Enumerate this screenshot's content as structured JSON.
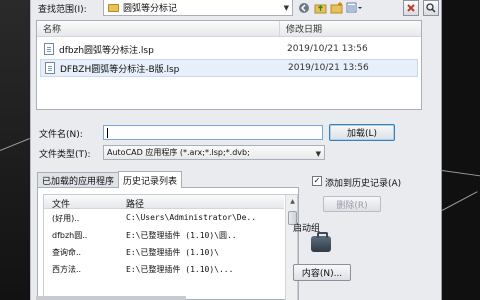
{
  "background": {
    "left_color": "#222222",
    "right_color": "#101010"
  },
  "dialog": {
    "look_in_label": "查找范围(I):",
    "look_in_value": "圆弧等分标记",
    "toolbar_icons": [
      "back-icon",
      "up-folder-icon",
      "new-folder-icon",
      "views-menu-icon"
    ],
    "right_buttons": [
      "delete-icon",
      "find-icon"
    ]
  },
  "filelist": {
    "col_name": "名称",
    "col_date": "修改日期",
    "files": [
      {
        "name": "dfbzh圆弧等分标注.lsp",
        "date": "2019/10/21 13:56",
        "selected": true
      },
      {
        "name": "DFBZH圆弧等分标注-B版.lsp",
        "date": "2019/10/21 13:56",
        "selected": false
      }
    ]
  },
  "filename": {
    "label": "文件名(N):",
    "value": ""
  },
  "filetype": {
    "label": "文件类型(T):",
    "value": "AutoCAD 应用程序 (*.arx;*.lsp;*.dvb;"
  },
  "buttons": {
    "load": "加载(L)",
    "remove": "删除(R)",
    "contents": "内容(N)..."
  },
  "tabs": [
    {
      "label": "已加载的应用程序",
      "active": false
    },
    {
      "label": "历史记录列表",
      "active": true
    }
  ],
  "history": {
    "col_file": "文件",
    "col_path": "路径",
    "rows": [
      {
        "file": "(好用)..",
        "path": "C:\\Users\\Administrator\\De.."
      },
      {
        "file": "dfbzh圆..",
        "path": "E:\\已整理插件 (1.10)\\圆.."
      },
      {
        "file": "查询命..",
        "path": "E:\\已整理插件 (1.10)\\"
      },
      {
        "file": "西方法..",
        "path": "E:\\已整理插件 (1.10)\\..."
      }
    ]
  },
  "add_history": {
    "label": "添加到历史记录(A)",
    "checked": true,
    "check_mark": "✓"
  },
  "startup": {
    "label": "启动组"
  }
}
